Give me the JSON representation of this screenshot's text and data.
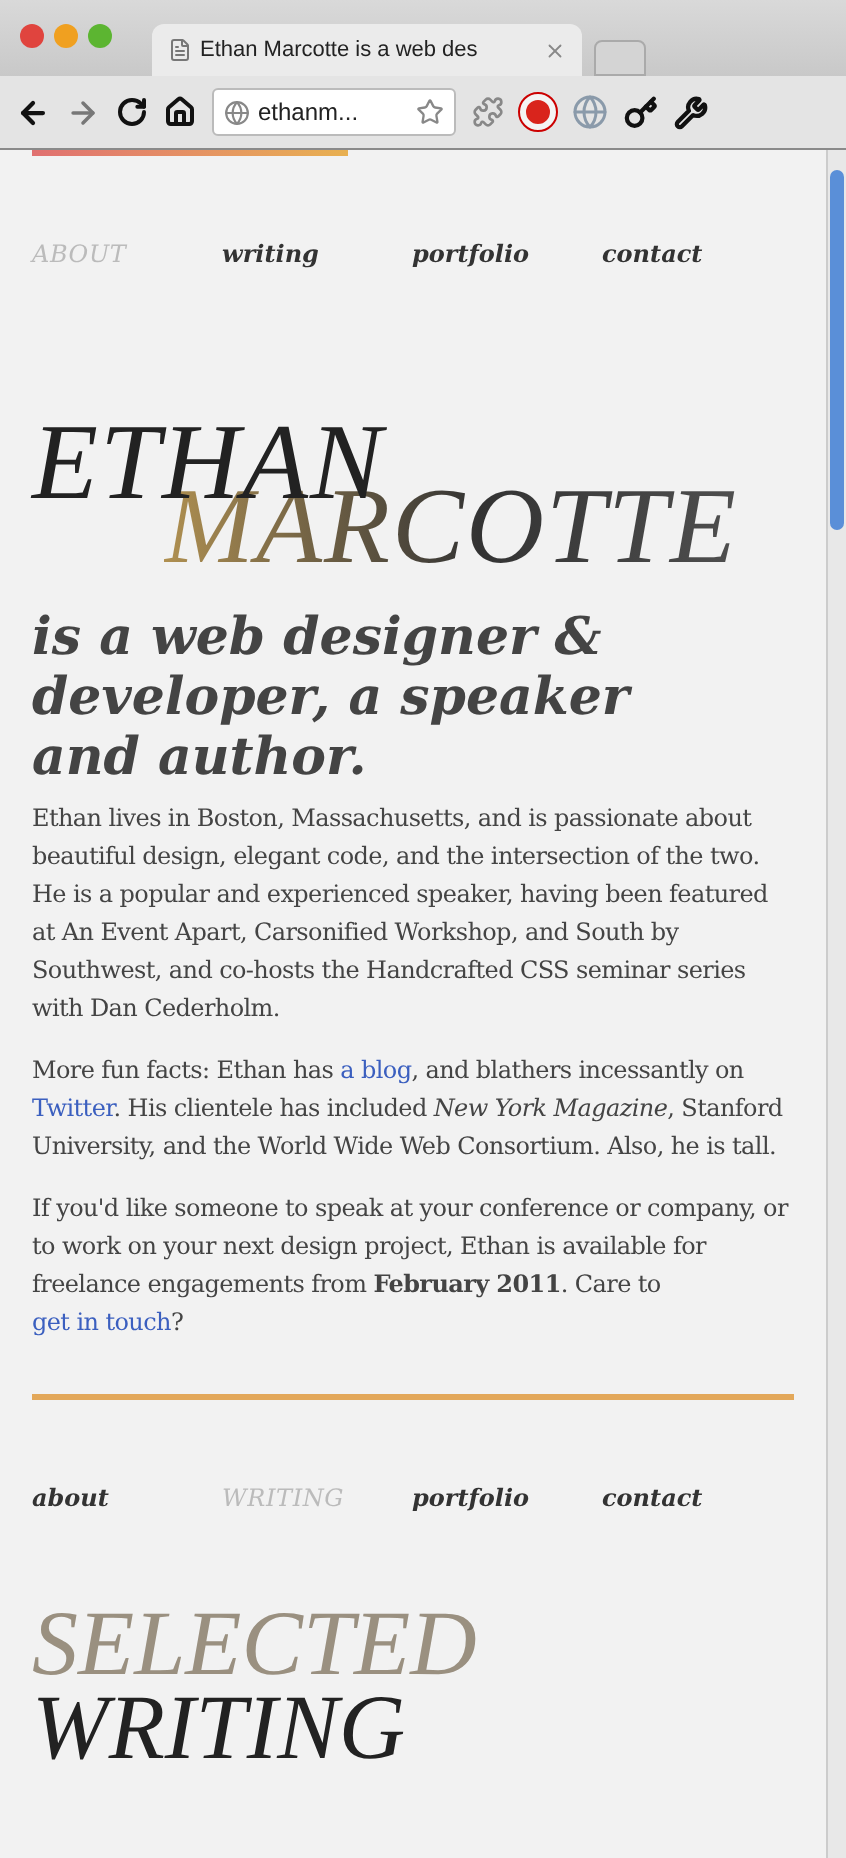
{
  "browser": {
    "tab_title": "Ethan Marcotte is a web des",
    "address": "ethanm..."
  },
  "nav": [
    {
      "label": "ABOUT",
      "selected": true
    },
    {
      "label": "writing",
      "selected": false
    },
    {
      "label": "portfolio",
      "selected": false
    },
    {
      "label": "contact",
      "selected": false
    }
  ],
  "name": [
    "ETHAN",
    "MARCOTTE"
  ],
  "tagline": "is a web designer & developer, a speaker and author.",
  "paragraphs": [
    [
      {
        "kind": "text",
        "text": "Ethan lives in Boston, Massachusetts, and is passionate about beautiful design, elegant code, and the intersection of the two. He is a popular and experienced speaker, having been featured at An Event Apart, Carsonified Workshop, and South by Southwest, and co-hosts the Handcrafted CSS seminar series with Dan Cederholm."
      }
    ],
    [
      {
        "kind": "text",
        "text": "More fun facts: Ethan has "
      },
      {
        "kind": "link",
        "text": "a blog"
      },
      {
        "kind": "text",
        "text": ", and blathers incessantly on "
      },
      {
        "kind": "link",
        "text": "Twitter"
      },
      {
        "kind": "text",
        "text": ". His clientele has included *New York Magazine*, Stanford University, and the World Wide Web Consortium. Also, he is tall."
      }
    ],
    [
      {
        "kind": "text",
        "text": "If you'd like someone to speak at your conference or company, or to work on your next design project, Ethan is available for freelance engagements from **February 2011**. Care to "
      },
      {
        "kind": "link",
        "text": "get in touch"
      },
      {
        "kind": "text",
        "text": "?"
      }
    ]
  ],
  "nav_2": [
    {
      "label": "about",
      "selected": false
    },
    {
      "label": "WRITING",
      "selected": true
    },
    {
      "label": "portfolio",
      "selected": false
    },
    {
      "label": "contact",
      "selected": false
    }
  ],
  "section_heading": [
    "SELECTED",
    "WRITING"
  ]
}
